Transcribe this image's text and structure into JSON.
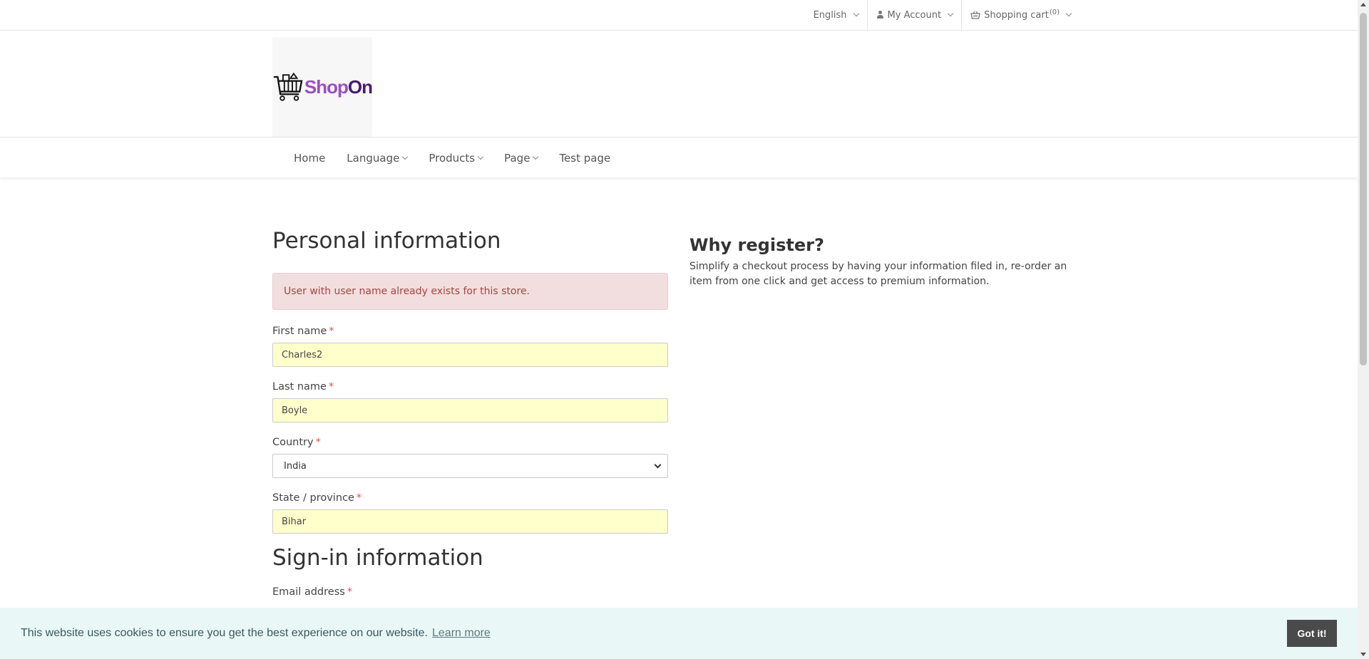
{
  "topbar": {
    "language": "English",
    "account": "My Account",
    "cart_label": "Shopping cart",
    "cart_count": "(0)"
  },
  "logo": {
    "shop": "Shop",
    "on": "On"
  },
  "nav": {
    "items": [
      {
        "label": "Home",
        "dropdown": false
      },
      {
        "label": "Language",
        "dropdown": true
      },
      {
        "label": "Products",
        "dropdown": true
      },
      {
        "label": "Page",
        "dropdown": true
      },
      {
        "label": "Test page",
        "dropdown": false
      }
    ]
  },
  "form": {
    "personal_title": "Personal information",
    "alert": "User with user name already exists for this store.",
    "first_name_label": "First name",
    "first_name_value": "Charles2",
    "last_name_label": "Last name",
    "last_name_value": "Boyle",
    "country_label": "Country",
    "country_value": "India",
    "state_label": "State / province",
    "state_value": "Bihar",
    "signin_title": "Sign-in information",
    "email_label": "Email address",
    "required_mark": "*"
  },
  "why": {
    "title": "Why register?",
    "text": "Simplify a checkout process by having your information filed in, re-order an item from one click and get access to premium information."
  },
  "cookie": {
    "message": "This website uses cookies to ensure you get the best experience on our website.",
    "link": "Learn more",
    "button": "Got it!"
  }
}
